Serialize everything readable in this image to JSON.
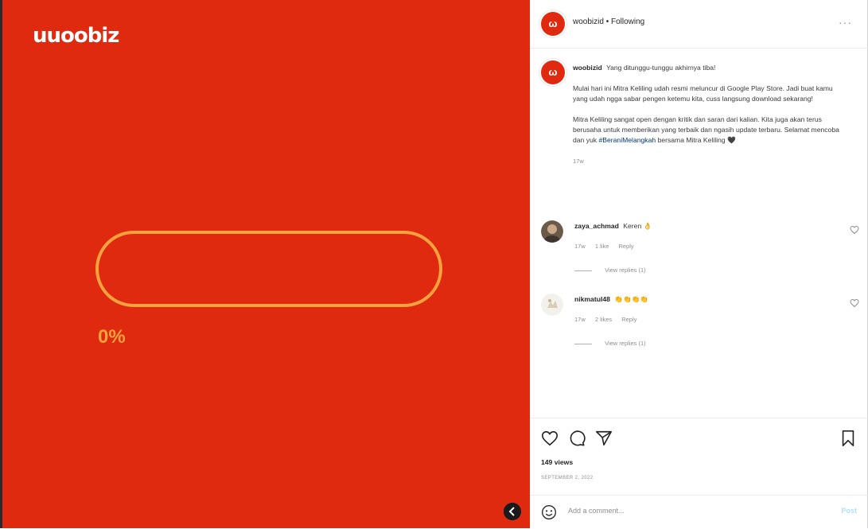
{
  "media": {
    "logo_text": "uuoobiz",
    "progress_text": "0%",
    "progress_fraction": 0,
    "accent_color": "#f7a23d",
    "background_color": "#e02a10"
  },
  "header": {
    "username": "woobizid",
    "separator": "•",
    "follow_label": "Following",
    "more_label": "···",
    "avatar_icon": "woobiz-logo-icon"
  },
  "caption": {
    "username": "woobizid",
    "first_line": "Yang ditunggu-tunggu akhirnya tiba!",
    "paragraph1": "Mulai hari ini Mitra Keliling udah resmi meluncur di Google Play Store. Jadi buat kamu yang udah ngga sabar pengen ketemu kita, cuss langsung download sekarang!",
    "paragraph2_pre": "Mitra Keliling sangat open dengan kritik dan saran dari kalian. Kita juga akan terus berusaha untuk memberikan yang terbaik dan ngasih update terbaru. Selamat mencoba dan yuk",
    "hashtag": "#BeraniMelangkah",
    "paragraph2_post": "bersama Mitra Keliling 🖤",
    "time": "17w"
  },
  "comments": [
    {
      "username": "zaya_achmad",
      "text": "Keren 👌",
      "time": "17w",
      "likes": "1 like",
      "reply_label": "Reply",
      "view_replies": "View replies (1)"
    },
    {
      "username": "nikmatul48",
      "text": "👏👏👏👏",
      "time": "17w",
      "likes": "2 likes",
      "reply_label": "Reply",
      "view_replies": "View replies (1)"
    }
  ],
  "actions": {
    "views": "149 views",
    "date": "SEPTEMBER 2, 2022"
  },
  "add_comment": {
    "placeholder": "Add a comment...",
    "post_label": "Post"
  }
}
